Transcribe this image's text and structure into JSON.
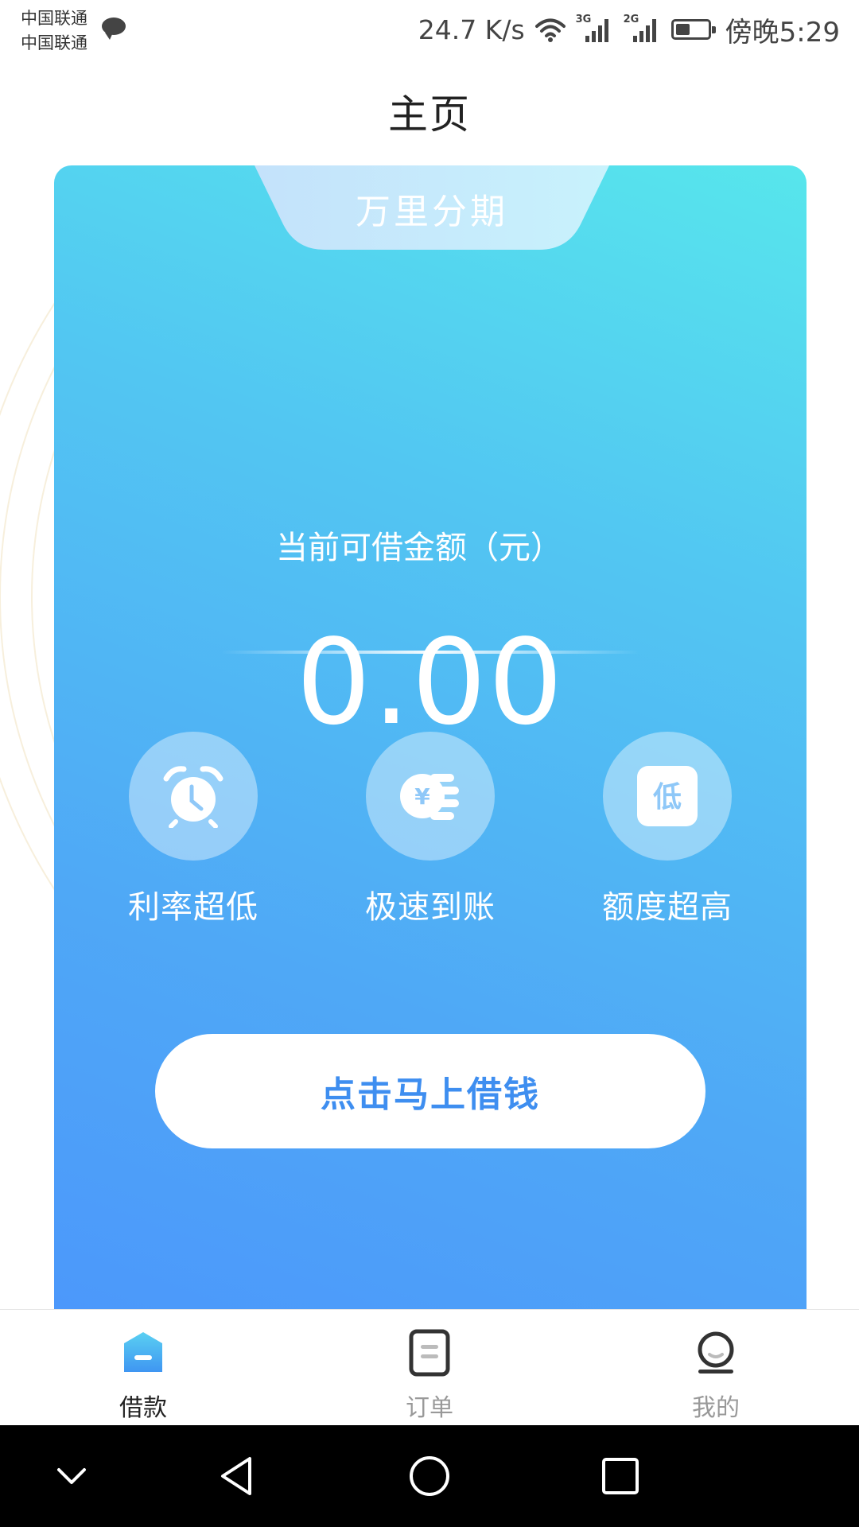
{
  "status_bar": {
    "carrier_1": "中国联通",
    "carrier_2": "中国联通",
    "net_speed": "24.7 K/s",
    "signal_1_tag": "3G",
    "signal_2_tag": "2G",
    "battery_level": 0.45,
    "time": "傍晚5:29"
  },
  "header": {
    "title": "主页"
  },
  "loan_card": {
    "brand": "万里分期",
    "amount_label": "当前可借金额（元）",
    "amount_value": "0.00",
    "features": [
      {
        "label": "利率超低",
        "icon": "alarm-clock-icon"
      },
      {
        "label": "极速到账",
        "icon": "yuan-coin-icon"
      },
      {
        "label": "额度超高",
        "icon": "low-badge-icon",
        "badge_char": "低"
      }
    ],
    "action_label": "点击马上借钱"
  },
  "tab_bar": {
    "items": [
      {
        "label": "借款",
        "icon": "home-icon",
        "active": true
      },
      {
        "label": "订单",
        "icon": "order-list-icon",
        "active": false
      },
      {
        "label": "我的",
        "icon": "profile-icon",
        "active": false
      }
    ]
  },
  "colors": {
    "accent_blue": "#4c98fb",
    "button_text": "#3e8ef0",
    "tab_active": "#222222",
    "tab_inactive": "#999999"
  }
}
